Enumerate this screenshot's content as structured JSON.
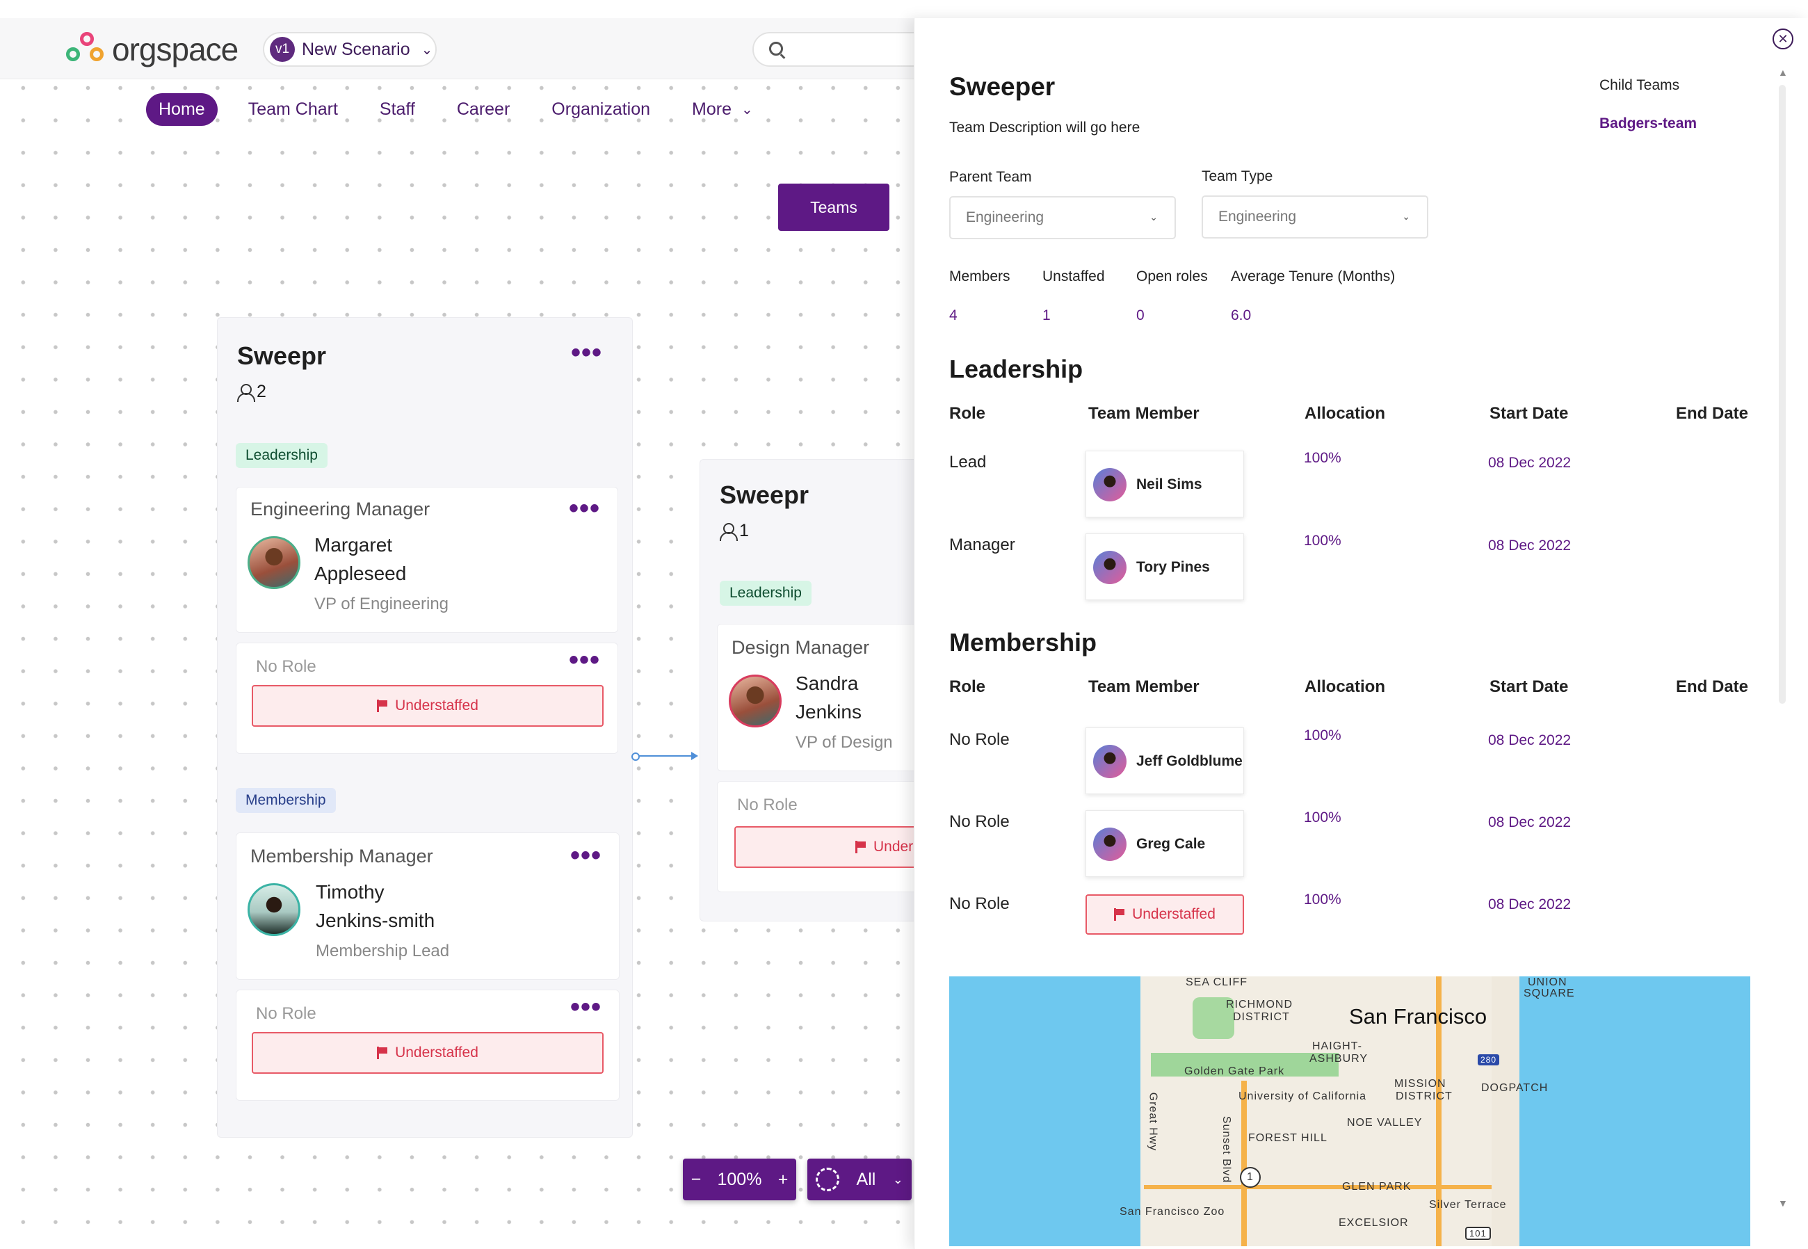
{
  "brand": {
    "logo_text": "orgspace"
  },
  "scenario": {
    "version": "v1",
    "name": "New Scenario"
  },
  "search": {
    "placeholder": ""
  },
  "nav": {
    "items": [
      "Home",
      "Team Chart",
      "Staff",
      "Career",
      "Organization",
      "More"
    ],
    "active": "Home"
  },
  "canvas": {
    "teams_button": "Teams",
    "team_cards": [
      {
        "title": "Sweepr",
        "member_count": "2",
        "leadership_tag": "Leadership",
        "roles": [
          {
            "title": "Engineering Manager",
            "name_line1": "Margaret",
            "name_line2": "Appleseed",
            "subtitle": "VP of Engineering"
          },
          {
            "title": "No Role",
            "status": "Understaffed"
          }
        ],
        "membership_tag": "Membership",
        "members": [
          {
            "title": "Membership Manager",
            "name_line1": "Timothy",
            "name_line2": "Jenkins-smith",
            "subtitle": "Membership Lead"
          },
          {
            "title": "No Role",
            "status": "Understaffed"
          }
        ]
      },
      {
        "title": "Sweepr",
        "member_count": "1",
        "leadership_tag": "Leadership",
        "roles": [
          {
            "title": "Design Manager",
            "name_line1": "Sandra",
            "name_line2": "Jenkins",
            "subtitle": "VP of Design"
          },
          {
            "title": "No Role",
            "status": "Understaffed",
            "visible_status": "Under"
          }
        ]
      }
    ],
    "zoom": {
      "minus": "−",
      "level": "100%",
      "plus": "+"
    },
    "filter": {
      "label": "All"
    }
  },
  "panel": {
    "title": "Sweeper",
    "description": "Team Description will go here",
    "child_teams_label": "Child Teams",
    "child_team": "Badgers-team",
    "parent_team_label": "Parent Team",
    "parent_team_value": "Engineering",
    "team_type_label": "Team Type",
    "team_type_value": "Engineering",
    "stats": [
      {
        "label": "Members",
        "value": "4"
      },
      {
        "label": "Unstaffed",
        "value": "1"
      },
      {
        "label": "Open roles",
        "value": "0"
      },
      {
        "label": "Average Tenure (Months)",
        "value": "6.0"
      }
    ],
    "columns": [
      "Role",
      "Team Member",
      "Allocation",
      "Start Date",
      "End Date"
    ],
    "leadership_title": "Leadership",
    "leadership_rows": [
      {
        "role": "Lead",
        "member": "Neil Sims",
        "allocation": "100%",
        "start": "08 Dec 2022",
        "end": ""
      },
      {
        "role": "Manager",
        "member": "Tory Pines",
        "allocation": "100%",
        "start": "08 Dec 2022",
        "end": ""
      }
    ],
    "membership_title": "Membership",
    "membership_rows": [
      {
        "role": "No Role",
        "member": "Jeff Goldblume",
        "allocation": "100%",
        "start": "08 Dec 2022",
        "end": ""
      },
      {
        "role": "No Role",
        "member": "Greg Cale",
        "allocation": "100%",
        "start": "08 Dec 2022",
        "end": ""
      },
      {
        "role": "No Role",
        "member": "Understaffed",
        "allocation": "100%",
        "start": "08 Dec 2022",
        "end": ""
      }
    ],
    "map_labels": {
      "city": "San Francisco",
      "sea_cliff": "SEA CLIFF",
      "richmond": "RICHMOND",
      "richmond2": "DISTRICT",
      "union": "UNION",
      "union2": "SQUARE",
      "haight": "HAIGHT-",
      "haight2": "ASHBURY",
      "ggpark": "Golden Gate Park",
      "ucal": "University of California",
      "mission": "MISSION",
      "mission2": "DISTRICT",
      "dogpatch": "DOGPATCH",
      "noe": "NOE VALLEY",
      "forest": "FOREST HILL",
      "glen": "GLEN PARK",
      "silver": "Silver Terrace",
      "zoo": "San Francisco Zoo",
      "excelsior": "EXCELSIOR",
      "great_hwy": "Great Hwy",
      "sunset": "Sunset Blvd",
      "hwy1": "1",
      "i280": "280",
      "us101": "101"
    }
  }
}
